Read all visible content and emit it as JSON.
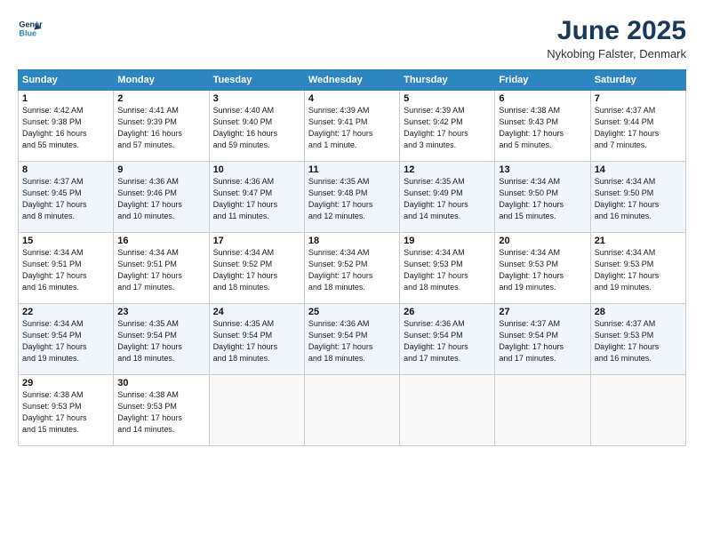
{
  "header": {
    "title": "June 2025",
    "location": "Nykobing Falster, Denmark"
  },
  "days": [
    "Sunday",
    "Monday",
    "Tuesday",
    "Wednesday",
    "Thursday",
    "Friday",
    "Saturday"
  ],
  "weeks": [
    [
      {
        "day": "1",
        "info": "Sunrise: 4:42 AM\nSunset: 9:38 PM\nDaylight: 16 hours\nand 55 minutes."
      },
      {
        "day": "2",
        "info": "Sunrise: 4:41 AM\nSunset: 9:39 PM\nDaylight: 16 hours\nand 57 minutes."
      },
      {
        "day": "3",
        "info": "Sunrise: 4:40 AM\nSunset: 9:40 PM\nDaylight: 16 hours\nand 59 minutes."
      },
      {
        "day": "4",
        "info": "Sunrise: 4:39 AM\nSunset: 9:41 PM\nDaylight: 17 hours\nand 1 minute."
      },
      {
        "day": "5",
        "info": "Sunrise: 4:39 AM\nSunset: 9:42 PM\nDaylight: 17 hours\nand 3 minutes."
      },
      {
        "day": "6",
        "info": "Sunrise: 4:38 AM\nSunset: 9:43 PM\nDaylight: 17 hours\nand 5 minutes."
      },
      {
        "day": "7",
        "info": "Sunrise: 4:37 AM\nSunset: 9:44 PM\nDaylight: 17 hours\nand 7 minutes."
      }
    ],
    [
      {
        "day": "8",
        "info": "Sunrise: 4:37 AM\nSunset: 9:45 PM\nDaylight: 17 hours\nand 8 minutes."
      },
      {
        "day": "9",
        "info": "Sunrise: 4:36 AM\nSunset: 9:46 PM\nDaylight: 17 hours\nand 10 minutes."
      },
      {
        "day": "10",
        "info": "Sunrise: 4:36 AM\nSunset: 9:47 PM\nDaylight: 17 hours\nand 11 minutes."
      },
      {
        "day": "11",
        "info": "Sunrise: 4:35 AM\nSunset: 9:48 PM\nDaylight: 17 hours\nand 12 minutes."
      },
      {
        "day": "12",
        "info": "Sunrise: 4:35 AM\nSunset: 9:49 PM\nDaylight: 17 hours\nand 14 minutes."
      },
      {
        "day": "13",
        "info": "Sunrise: 4:34 AM\nSunset: 9:50 PM\nDaylight: 17 hours\nand 15 minutes."
      },
      {
        "day": "14",
        "info": "Sunrise: 4:34 AM\nSunset: 9:50 PM\nDaylight: 17 hours\nand 16 minutes."
      }
    ],
    [
      {
        "day": "15",
        "info": "Sunrise: 4:34 AM\nSunset: 9:51 PM\nDaylight: 17 hours\nand 16 minutes."
      },
      {
        "day": "16",
        "info": "Sunrise: 4:34 AM\nSunset: 9:51 PM\nDaylight: 17 hours\nand 17 minutes."
      },
      {
        "day": "17",
        "info": "Sunrise: 4:34 AM\nSunset: 9:52 PM\nDaylight: 17 hours\nand 18 minutes."
      },
      {
        "day": "18",
        "info": "Sunrise: 4:34 AM\nSunset: 9:52 PM\nDaylight: 17 hours\nand 18 minutes."
      },
      {
        "day": "19",
        "info": "Sunrise: 4:34 AM\nSunset: 9:53 PM\nDaylight: 17 hours\nand 18 minutes."
      },
      {
        "day": "20",
        "info": "Sunrise: 4:34 AM\nSunset: 9:53 PM\nDaylight: 17 hours\nand 19 minutes."
      },
      {
        "day": "21",
        "info": "Sunrise: 4:34 AM\nSunset: 9:53 PM\nDaylight: 17 hours\nand 19 minutes."
      }
    ],
    [
      {
        "day": "22",
        "info": "Sunrise: 4:34 AM\nSunset: 9:54 PM\nDaylight: 17 hours\nand 19 minutes."
      },
      {
        "day": "23",
        "info": "Sunrise: 4:35 AM\nSunset: 9:54 PM\nDaylight: 17 hours\nand 18 minutes."
      },
      {
        "day": "24",
        "info": "Sunrise: 4:35 AM\nSunset: 9:54 PM\nDaylight: 17 hours\nand 18 minutes."
      },
      {
        "day": "25",
        "info": "Sunrise: 4:36 AM\nSunset: 9:54 PM\nDaylight: 17 hours\nand 18 minutes."
      },
      {
        "day": "26",
        "info": "Sunrise: 4:36 AM\nSunset: 9:54 PM\nDaylight: 17 hours\nand 17 minutes."
      },
      {
        "day": "27",
        "info": "Sunrise: 4:37 AM\nSunset: 9:54 PM\nDaylight: 17 hours\nand 17 minutes."
      },
      {
        "day": "28",
        "info": "Sunrise: 4:37 AM\nSunset: 9:53 PM\nDaylight: 17 hours\nand 16 minutes."
      }
    ],
    [
      {
        "day": "29",
        "info": "Sunrise: 4:38 AM\nSunset: 9:53 PM\nDaylight: 17 hours\nand 15 minutes."
      },
      {
        "day": "30",
        "info": "Sunrise: 4:38 AM\nSunset: 9:53 PM\nDaylight: 17 hours\nand 14 minutes."
      },
      null,
      null,
      null,
      null,
      null
    ]
  ]
}
